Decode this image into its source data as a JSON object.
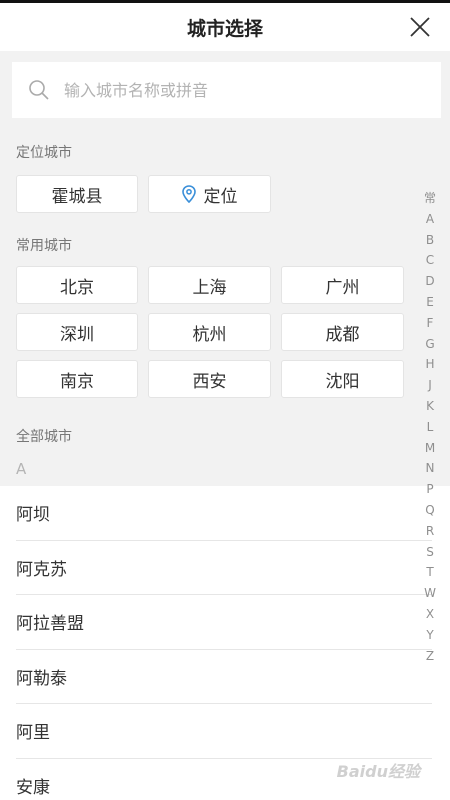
{
  "header": {
    "title": "城市选择"
  },
  "search": {
    "placeholder": "输入城市名称或拼音"
  },
  "sections": {
    "located_title": "定位城市",
    "common_title": "常用城市",
    "all_title": "全部城市"
  },
  "located": {
    "city": "霍城县",
    "locate_label": "定位"
  },
  "common_cities": [
    "北京",
    "上海",
    "广州",
    "深圳",
    "杭州",
    "成都",
    "南京",
    "西安",
    "沈阳"
  ],
  "all": {
    "group_letter": "A",
    "cities": [
      "阿坝",
      "阿克苏",
      "阿拉善盟",
      "阿勒泰",
      "阿里",
      "安康"
    ]
  },
  "index_letters": [
    "常",
    "A",
    "B",
    "C",
    "D",
    "E",
    "F",
    "G",
    "H",
    "J",
    "K",
    "L",
    "M",
    "N",
    "P",
    "Q",
    "R",
    "S",
    "T",
    "W",
    "X",
    "Y",
    "Z"
  ],
  "watermark": "Baidu经验",
  "colors": {
    "accent_icon": "#3a8fd9",
    "background": "#f2f2f2"
  },
  "icons": {
    "close": "close-icon",
    "search": "search-icon",
    "location": "location-pin-icon"
  }
}
